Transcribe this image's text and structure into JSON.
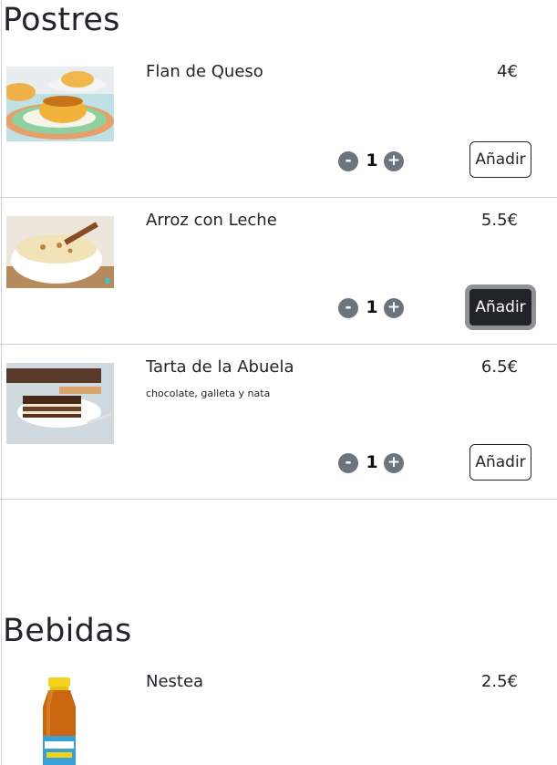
{
  "sections": [
    {
      "title": "Postres",
      "items": [
        {
          "name": "Flan de Queso",
          "description": "",
          "price": "4€",
          "quantity": "1",
          "add_label": "Añadir",
          "image": "flan-image"
        },
        {
          "name": "Arroz con Leche",
          "description": "",
          "price": "5.5€",
          "quantity": "1",
          "add_label": "Añadir",
          "image": "rice-pudding-image"
        },
        {
          "name": "Tarta de la Abuela",
          "description": "chocolate, galleta y nata",
          "price": "6.5€",
          "quantity": "1",
          "add_label": "Añadir",
          "image": "cake-image"
        }
      ]
    },
    {
      "title": "Bebidas",
      "items": [
        {
          "name": "Nestea",
          "description": "",
          "price": "2.5€",
          "image": "nestea-bottle-image"
        }
      ]
    }
  ],
  "controls": {
    "minus_symbol": "-",
    "plus_symbol": "+"
  },
  "colors": {
    "text": "#212529",
    "qty_button": "#6c757d",
    "active_button_bg": "#212529",
    "active_button_ring": "#8e9296",
    "divider": "#cfcfcf"
  }
}
